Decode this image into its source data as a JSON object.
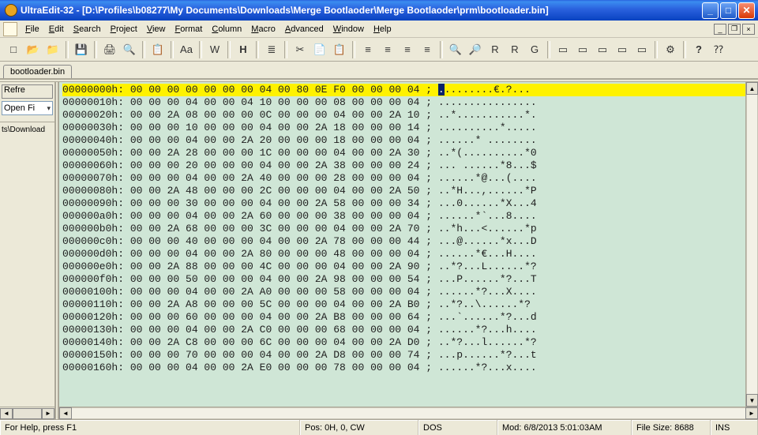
{
  "title": "UltraEdit-32 - [D:\\Profiles\\b08277\\My Documents\\Downloads\\Merge Bootlaoder\\Merge Bootlaoder\\prm\\bootloader.bin]",
  "menu": [
    "File",
    "Edit",
    "Search",
    "Project",
    "View",
    "Format",
    "Column",
    "Macro",
    "Advanced",
    "Window",
    "Help"
  ],
  "tab_label": "bootloader.bin",
  "side": {
    "refresh": "Refre",
    "openfi": "Open Fi",
    "path": "ts\\Download"
  },
  "toolbar": {
    "new": "□",
    "open": "📂",
    "fav": "📁",
    "save": "💾",
    "print": "🖨",
    "preview": "🔍",
    "copyfmt": "📋",
    "font": "Aa",
    "word": "W",
    "hex": "H",
    "align": "≣",
    "cut": "✂",
    "copy": "📄",
    "paste": "📋",
    "al1": "≡",
    "al2": "≡",
    "al3": "≡",
    "al4": "≡",
    "find": "🔍",
    "findnext": "🔎",
    "replace": "R",
    "goto": "G",
    "win1": "▭",
    "win2": "▭",
    "win3": "▭",
    "win4": "▭",
    "win5": "▭",
    "cfg": "⚙",
    "help": "?",
    "whats": "⁇"
  },
  "status": {
    "help": "For Help, press F1",
    "pos": "Pos: 0H, 0, CW",
    "enc": "DOS",
    "mod": "Mod: 6/8/2013 5:01:03AM",
    "size": "File Size: 8688",
    "ins": "INS"
  },
  "hex_rows": [
    {
      "addr": "00000000h:",
      "bytes": "00 00 00 00 00 00 00 04 00 80 0E F0 00 00 00 04",
      "ascii": ".........€.?...",
      "sel": true
    },
    {
      "addr": "00000010h:",
      "bytes": "00 00 00 04 00 00 04 10 00 00 00 08 00 00 00 04",
      "ascii": "................"
    },
    {
      "addr": "00000020h:",
      "bytes": "00 00 2A 08 00 00 00 0C 00 00 00 04 00 00 2A 10",
      "ascii": "..*...........*."
    },
    {
      "addr": "00000030h:",
      "bytes": "00 00 00 10 00 00 00 04 00 00 2A 18 00 00 00 14",
      "ascii": "..........*....."
    },
    {
      "addr": "00000040h:",
      "bytes": "00 00 00 04 00 00 2A 20 00 00 00 18 00 00 00 04",
      "ascii": "......* ........"
    },
    {
      "addr": "00000050h:",
      "bytes": "00 00 2A 28 00 00 00 1C 00 00 00 04 00 00 2A 30",
      "ascii": "..*(..........*0"
    },
    {
      "addr": "00000060h:",
      "bytes": "00 00 00 20 00 00 00 04 00 00 2A 38 00 00 00 24",
      "ascii": "... ......*8...$"
    },
    {
      "addr": "00000070h:",
      "bytes": "00 00 00 04 00 00 2A 40 00 00 00 28 00 00 00 04",
      "ascii": "......*@...(...."
    },
    {
      "addr": "00000080h:",
      "bytes": "00 00 2A 48 00 00 00 2C 00 00 00 04 00 00 2A 50",
      "ascii": "..*H...,......*P"
    },
    {
      "addr": "00000090h:",
      "bytes": "00 00 00 30 00 00 00 04 00 00 2A 58 00 00 00 34",
      "ascii": "...0......*X...4"
    },
    {
      "addr": "000000a0h:",
      "bytes": "00 00 00 04 00 00 2A 60 00 00 00 38 00 00 00 04",
      "ascii": "......*`...8...."
    },
    {
      "addr": "000000b0h:",
      "bytes": "00 00 2A 68 00 00 00 3C 00 00 00 04 00 00 2A 70",
      "ascii": "..*h...<......*p"
    },
    {
      "addr": "000000c0h:",
      "bytes": "00 00 00 40 00 00 00 04 00 00 2A 78 00 00 00 44",
      "ascii": "...@......*x...D"
    },
    {
      "addr": "000000d0h:",
      "bytes": "00 00 00 04 00 00 2A 80 00 00 00 48 00 00 00 04",
      "ascii": "......*€...H...."
    },
    {
      "addr": "000000e0h:",
      "bytes": "00 00 2A 88 00 00 00 4C 00 00 00 04 00 00 2A 90",
      "ascii": "..*?...L......*?"
    },
    {
      "addr": "000000f0h:",
      "bytes": "00 00 00 50 00 00 00 04 00 00 2A 98 00 00 00 54",
      "ascii": "...P......*?...T"
    },
    {
      "addr": "00000100h:",
      "bytes": "00 00 00 04 00 00 2A A0 00 00 00 58 00 00 00 04",
      "ascii": "......*?...X...."
    },
    {
      "addr": "00000110h:",
      "bytes": "00 00 2A A8 00 00 00 5C 00 00 00 04 00 00 2A B0",
      "ascii": "..*?..\\......*?"
    },
    {
      "addr": "00000120h:",
      "bytes": "00 00 00 60 00 00 00 04 00 00 2A B8 00 00 00 64",
      "ascii": "...`......*?...d"
    },
    {
      "addr": "00000130h:",
      "bytes": "00 00 00 04 00 00 2A C0 00 00 00 68 00 00 00 04",
      "ascii": "......*?...h...."
    },
    {
      "addr": "00000140h:",
      "bytes": "00 00 2A C8 00 00 00 6C 00 00 00 04 00 00 2A D0",
      "ascii": "..*?...l......*?"
    },
    {
      "addr": "00000150h:",
      "bytes": "00 00 00 70 00 00 00 04 00 00 2A D8 00 00 00 74",
      "ascii": "...p......*?...t"
    },
    {
      "addr": "00000160h:",
      "bytes": "00 00 00 04 00 00 2A E0 00 00 00 78 00 00 00 04",
      "ascii": "......*?...x...."
    }
  ]
}
